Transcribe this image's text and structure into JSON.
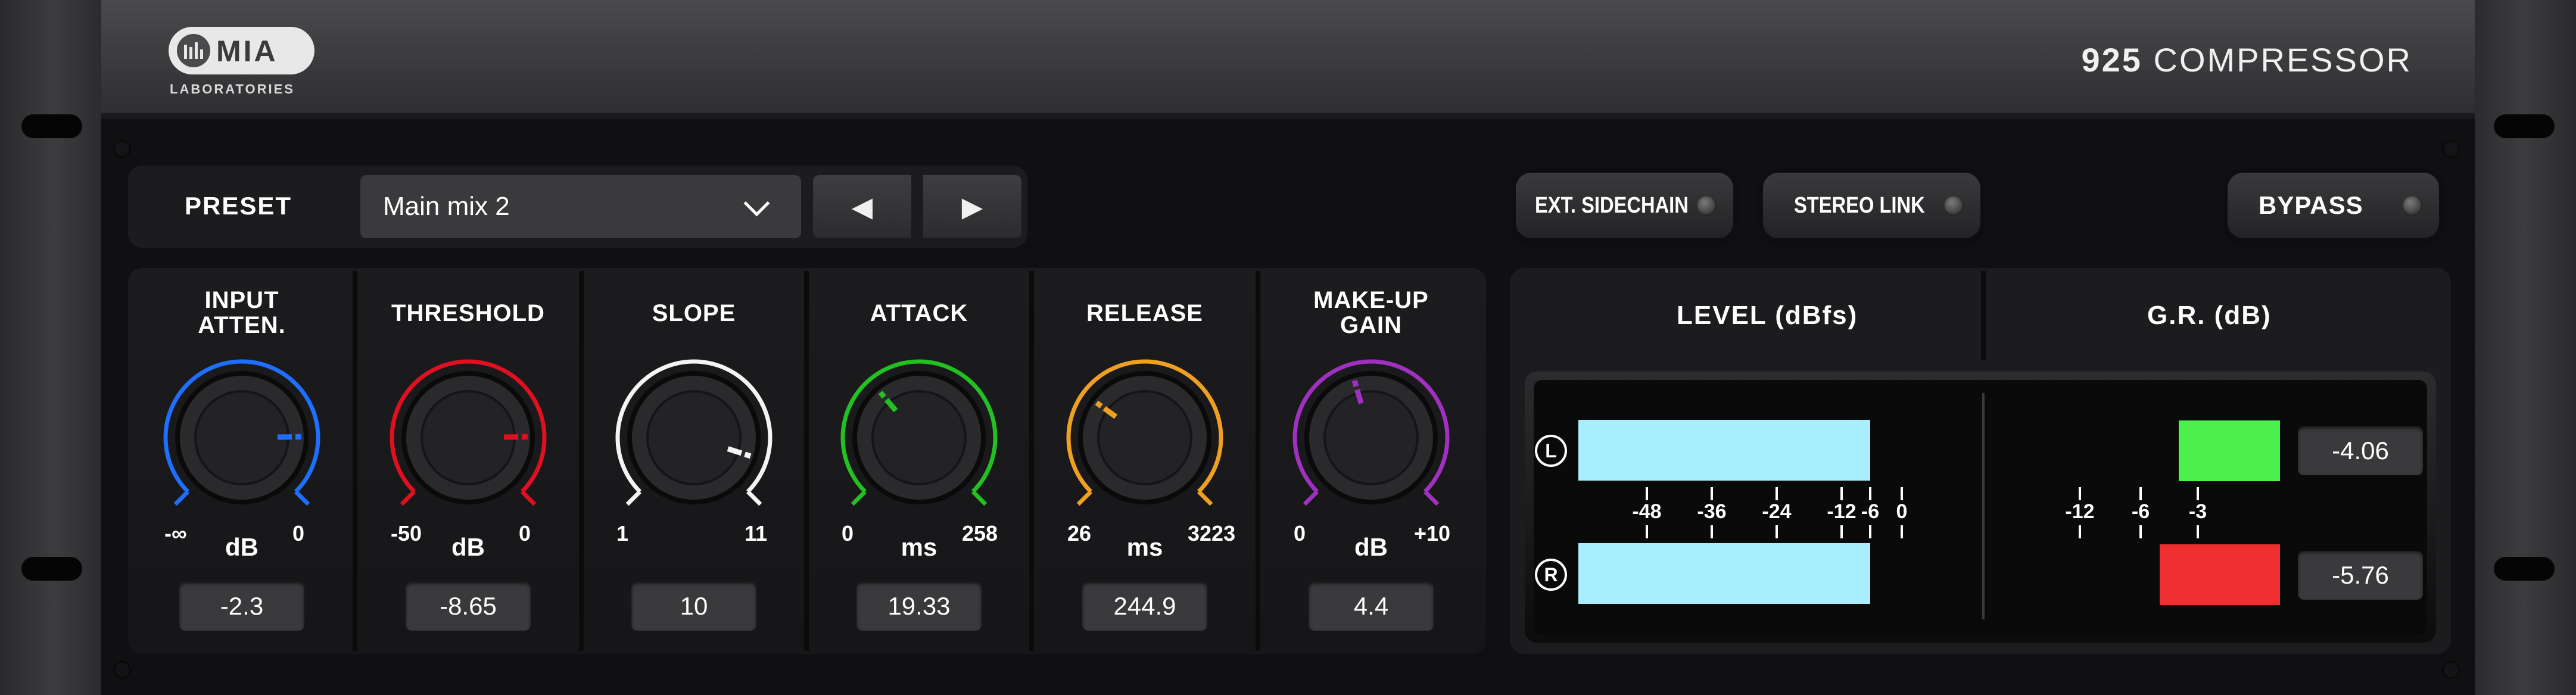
{
  "header": {
    "brand_name": "MIA",
    "brand_sub": "LABORATORIES",
    "product_number": "925",
    "product_name": "COMPRESSOR"
  },
  "preset": {
    "label": "PRESET",
    "value": "Main mix 2",
    "prev_glyph": "◀",
    "next_glyph": "▶"
  },
  "toggles": {
    "ext_sidechain": "EXT. SIDECHAIN",
    "stereo_link": "STEREO LINK",
    "bypass": "BYPASS"
  },
  "knobs": [
    {
      "label": "INPUT\nATTEN.",
      "min": "-∞",
      "unit": "dB",
      "max": "0",
      "value": "-2.3",
      "color": "#1f6fff",
      "level": 0.83
    },
    {
      "label": "THRESHOLD",
      "min": "-50",
      "unit": "dB",
      "max": "0",
      "value": "-8.65",
      "color": "#e01020",
      "level": 0.83
    },
    {
      "label": "SLOPE",
      "min": "1",
      "unit": "",
      "max": "11",
      "value": "10",
      "color": "#f4f4f4",
      "level": 0.9
    },
    {
      "label": "ATTACK",
      "min": "0",
      "unit": "ms",
      "max": "258",
      "value": "19.33",
      "color": "#22c020",
      "level": 0.35
    },
    {
      "label": "RELEASE",
      "min": "26",
      "unit": "ms",
      "max": "3223",
      "value": "244.9",
      "color": "#f0a020",
      "level": 0.3
    },
    {
      "label": "MAKE-UP\nGAIN",
      "min": "0",
      "unit": "dB",
      "max": "+10",
      "value": "4.4",
      "color": "#a030c0",
      "level": 0.44
    }
  ],
  "meters": {
    "level_title": "LEVEL (dBfs)",
    "gr_title": "G.R. (dB)",
    "channel_left": "L",
    "channel_right": "R",
    "level_ticks": [
      "-48",
      "-36",
      "-24",
      "-12",
      "-6",
      "0"
    ],
    "gr_ticks": [
      "-12",
      "-6",
      "-3"
    ],
    "level_bar_color": "#a8eeff",
    "gr_left_color": "#4cf04c",
    "gr_right_color": "#f03030",
    "gr_left_value": "-4.06",
    "gr_right_value": "-5.76",
    "level_left_db": -6,
    "level_right_db": -6
  }
}
